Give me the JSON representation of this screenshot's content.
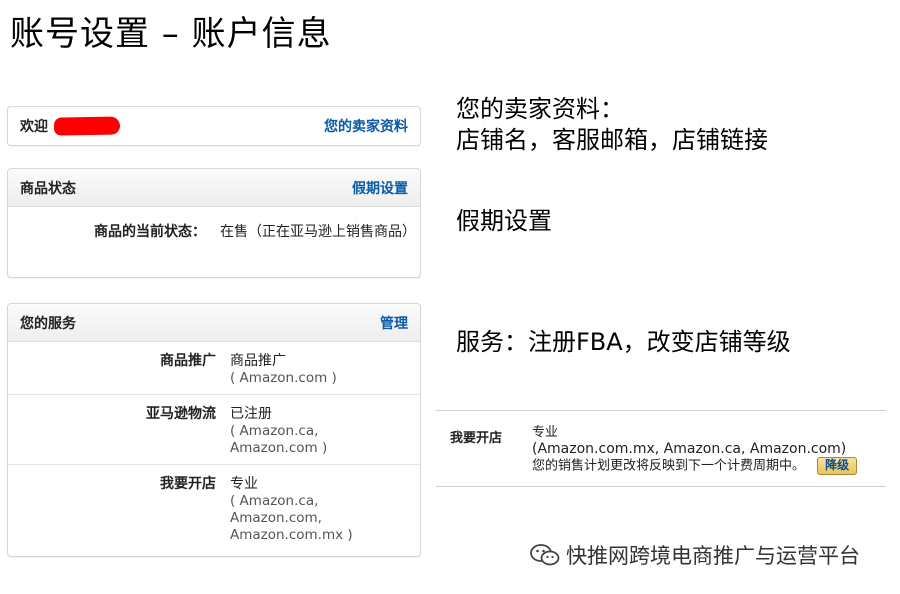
{
  "slide": {
    "title": "账号设置 – 账户信息"
  },
  "welcome_panel": {
    "label": "欢迎",
    "link": "您的卖家资料"
  },
  "status_panel": {
    "title": "商品状态",
    "link": "假期设置",
    "row_label": "商品的当前状态：",
    "row_value": "在售（正在亚马逊上销售商品）"
  },
  "services_panel": {
    "title": "您的服务",
    "link": "管理",
    "rows": [
      {
        "label": "商品推广",
        "value": "商品推广",
        "detail": "( Amazon.com )"
      },
      {
        "label": "亚马逊物流",
        "value": "已注册",
        "detail": "( Amazon.ca,\nAmazon.com )"
      },
      {
        "label": "我要开店",
        "value": "专业",
        "detail": "( Amazon.ca,\nAmazon.com,\nAmazon.com.mx )"
      }
    ]
  },
  "notes": {
    "profile_line1": "您的卖家资料：",
    "profile_line2": "店铺名，客服邮箱，店铺链接",
    "vacation": "假期设置",
    "services": "服务：注册FBA，改变店铺等级"
  },
  "seller_plan": {
    "label": "我要开店",
    "plan": "专业",
    "marketplaces": "(Amazon.com.mx, Amazon.ca, Amazon.com)",
    "notice": "您的销售计划更改将反映到下一个计费周期中。",
    "button": "降级"
  },
  "watermark": {
    "text": "快推网跨境电商推广与运营平台"
  }
}
